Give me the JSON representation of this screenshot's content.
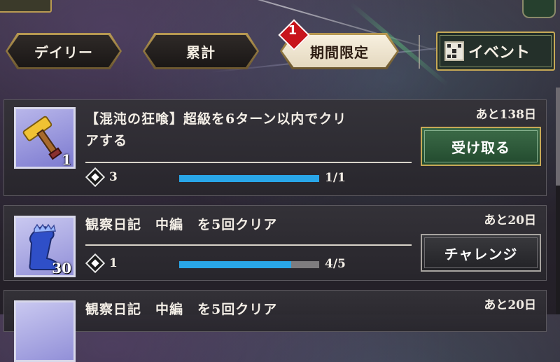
{
  "tabs": [
    {
      "label": "デイリー",
      "active": false
    },
    {
      "label": "累計",
      "active": false
    },
    {
      "label": "期間限定",
      "active": true,
      "badge": "1"
    }
  ],
  "event_button": {
    "label": "イベント",
    "icon": "grid-icon"
  },
  "missions": [
    {
      "title": "【混沌の狂喰】超級を6ターン以内でクリアする",
      "title_line1": "【混沌の狂喰】超級を6ターン以内でクリ",
      "title_line2": "アする",
      "remaining": "あと138日",
      "item_icon": "hammer-icon",
      "item_qty": "1",
      "reward_count": "3",
      "progress_text": "1/1",
      "progress": 1.0,
      "button": "受け取る"
    },
    {
      "title": "観察日記　中編　を5回クリア",
      "remaining": "あと20日",
      "item_icon": "boot-icon",
      "item_qty": "30",
      "reward_count": "1",
      "progress_text": "4/5",
      "progress": 0.8,
      "button": "チャレンジ"
    },
    {
      "title": "観察日記　中編　を5回クリア",
      "remaining": "あと20日",
      "item_icon": "item-icon"
    }
  ],
  "colors": {
    "progress_fill": "#29a6e8",
    "badge": "#c8141c",
    "gold_border": "#c7a956",
    "claim_green": "#3c6b48"
  }
}
